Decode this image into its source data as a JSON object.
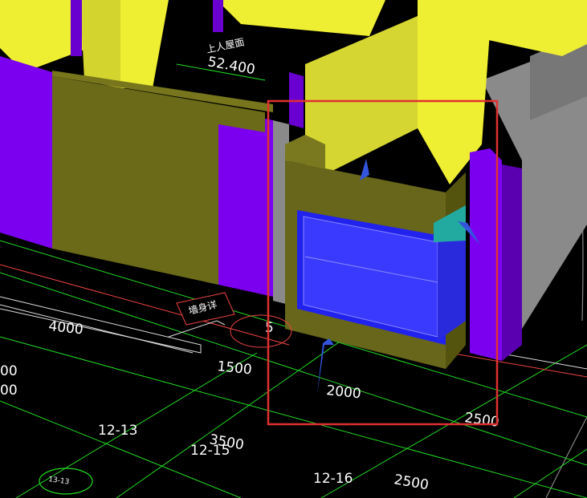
{
  "scene": {
    "roof_label": "上人屋面",
    "roof_elevation": "52.400",
    "wall_tag": "墙身详",
    "circle_tag": "5",
    "axis_bubble": "13-13",
    "axis_labels": [
      "12-13",
      "12-15",
      "12-16"
    ],
    "dimensions": [
      "4000",
      "1500",
      "2000",
      "3500",
      "2500",
      "2500",
      "00",
      "00"
    ]
  },
  "colors": {
    "wall_olive": "#6b6a18",
    "column_purple": "#7b00ef",
    "slab_yellow": "#eeee33",
    "wall_gray": "#8a8a8a",
    "glass_blue": "#2222ee",
    "teal": "#22aaa0",
    "highlight_red": "#e03030",
    "grid_green": "#22dd22"
  }
}
